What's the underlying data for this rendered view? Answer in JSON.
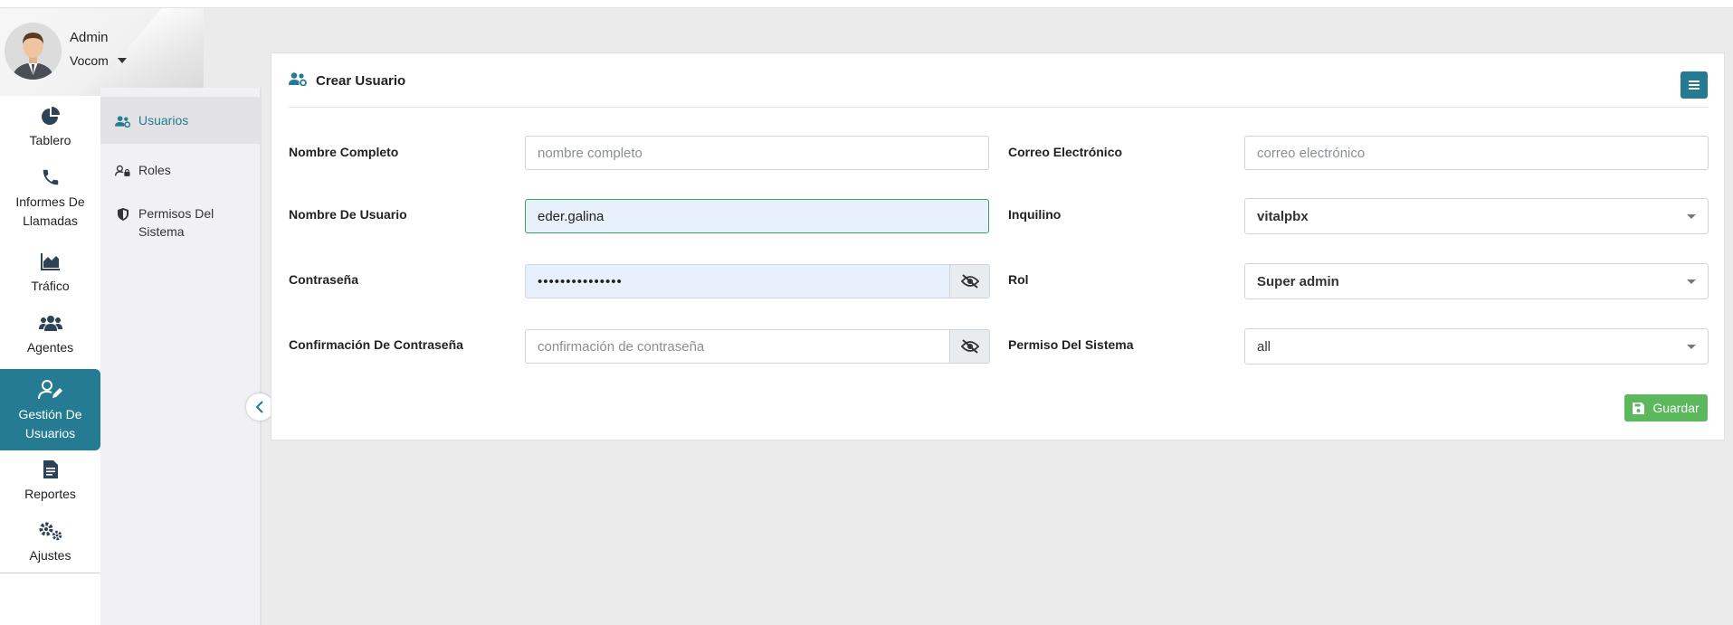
{
  "user": {
    "name": "Admin",
    "company": "Vocom"
  },
  "nav": {
    "items": [
      {
        "label": "Tablero",
        "icon": "chart-pie-icon"
      },
      {
        "label": "Informes De Llamadas",
        "icon": "phone-icon"
      },
      {
        "label": "Tráfico",
        "icon": "area-chart-icon"
      },
      {
        "label": "Agentes",
        "icon": "users-icon"
      },
      {
        "label": "Gestión De Usuarios",
        "icon": "user-edit-icon",
        "active": true
      },
      {
        "label": "Reportes",
        "icon": "file-report-icon"
      },
      {
        "label": "Ajustes",
        "icon": "gears-icon"
      }
    ]
  },
  "subnav": {
    "items": [
      {
        "label": "Usuarios",
        "icon": "users-cog-icon",
        "active": true
      },
      {
        "label": "Roles",
        "icon": "user-lock-icon"
      },
      {
        "label": "Permisos Del Sistema",
        "icon": "shield-icon"
      }
    ]
  },
  "form": {
    "title": "Crear Usuario",
    "full_name": {
      "label": "Nombre Completo",
      "value": "",
      "placeholder": "nombre completo"
    },
    "email": {
      "label": "Correo Electrónico",
      "value": "",
      "placeholder": "correo electrónico"
    },
    "username": {
      "label": "Nombre De Usuario",
      "value": "eder.galina"
    },
    "tenant": {
      "label": "Inquilino",
      "value": "vitalpbx"
    },
    "password": {
      "label": "Contraseña",
      "value": "•••••••••••••••"
    },
    "role": {
      "label": "Rol",
      "value": "Super admin"
    },
    "password_confirm": {
      "label": "Confirmación De Contraseña",
      "value": "",
      "placeholder": "confirmación de contraseña"
    },
    "system_permission": {
      "label": "Permiso Del Sistema",
      "value": "all"
    },
    "save_label": "Guardar"
  },
  "colors": {
    "accent": "#257b91",
    "success": "#5cb85c",
    "background": "#ebebeb"
  }
}
